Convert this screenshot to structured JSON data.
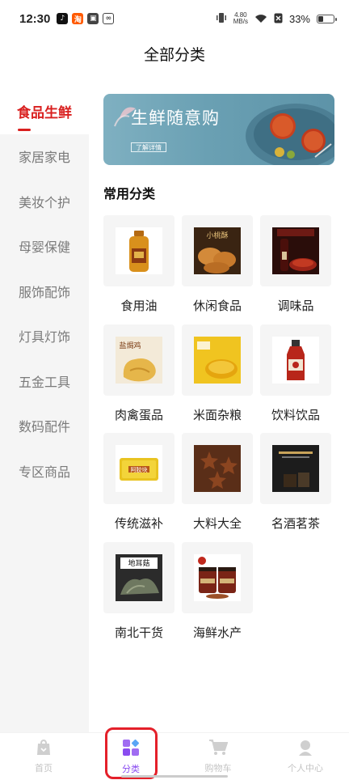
{
  "status_bar": {
    "time": "12:30",
    "net_speed_value": "4.80",
    "net_speed_unit": "MB/s",
    "battery_percent": "33%",
    "battery_level": 0.33,
    "app_icons": [
      "tiktok-icon",
      "taobao-icon",
      "store-icon",
      "link-icon"
    ]
  },
  "header": {
    "title": "全部分类"
  },
  "sidebar": {
    "items": [
      {
        "label": "食品生鲜",
        "active": true
      },
      {
        "label": "家居家电"
      },
      {
        "label": "美妆个护"
      },
      {
        "label": "母婴保健"
      },
      {
        "label": "服饰配饰"
      },
      {
        "label": "灯具灯饰"
      },
      {
        "label": "五金工具"
      },
      {
        "label": "数码配件"
      },
      {
        "label": "专区商品"
      }
    ]
  },
  "banner": {
    "title": "生鲜随意购",
    "button_label": "了解详情"
  },
  "section": {
    "title": "常用分类"
  },
  "categories": [
    {
      "label": "食用油",
      "icon": "cooking-oil-bottle"
    },
    {
      "label": "休闲食品",
      "icon": "cookies",
      "thumb_text": "小桃酥"
    },
    {
      "label": "调味品",
      "icon": "sauce-bottle"
    },
    {
      "label": "肉禽蛋品",
      "icon": "salted-chicken",
      "thumb_text": "盐焗鸡"
    },
    {
      "label": "米面杂粮",
      "icon": "millet-grain"
    },
    {
      "label": "饮料饮品",
      "icon": "juice-bottle"
    },
    {
      "label": "传统滋补",
      "icon": "ejiao-box",
      "thumb_text": "阿胶块"
    },
    {
      "label": "大料大全",
      "icon": "star-anise"
    },
    {
      "label": "名酒茗茶",
      "icon": "tea-box"
    },
    {
      "label": "南北干货",
      "icon": "dried-goods",
      "thumb_text": "地耳菇"
    },
    {
      "label": "海鲜水产",
      "icon": "seafood-jars"
    }
  ],
  "bottom_nav": {
    "items": [
      {
        "label": "首页",
        "icon": "home-bag-icon"
      },
      {
        "label": "分类",
        "icon": "category-grid-icon",
        "active": true
      },
      {
        "label": "购物车",
        "icon": "cart-icon"
      },
      {
        "label": "个人中心",
        "icon": "person-icon"
      }
    ]
  },
  "colors": {
    "accent_red": "#d9201f",
    "nav_active": "#8a4cf0",
    "highlight_red": "#e4202a"
  }
}
